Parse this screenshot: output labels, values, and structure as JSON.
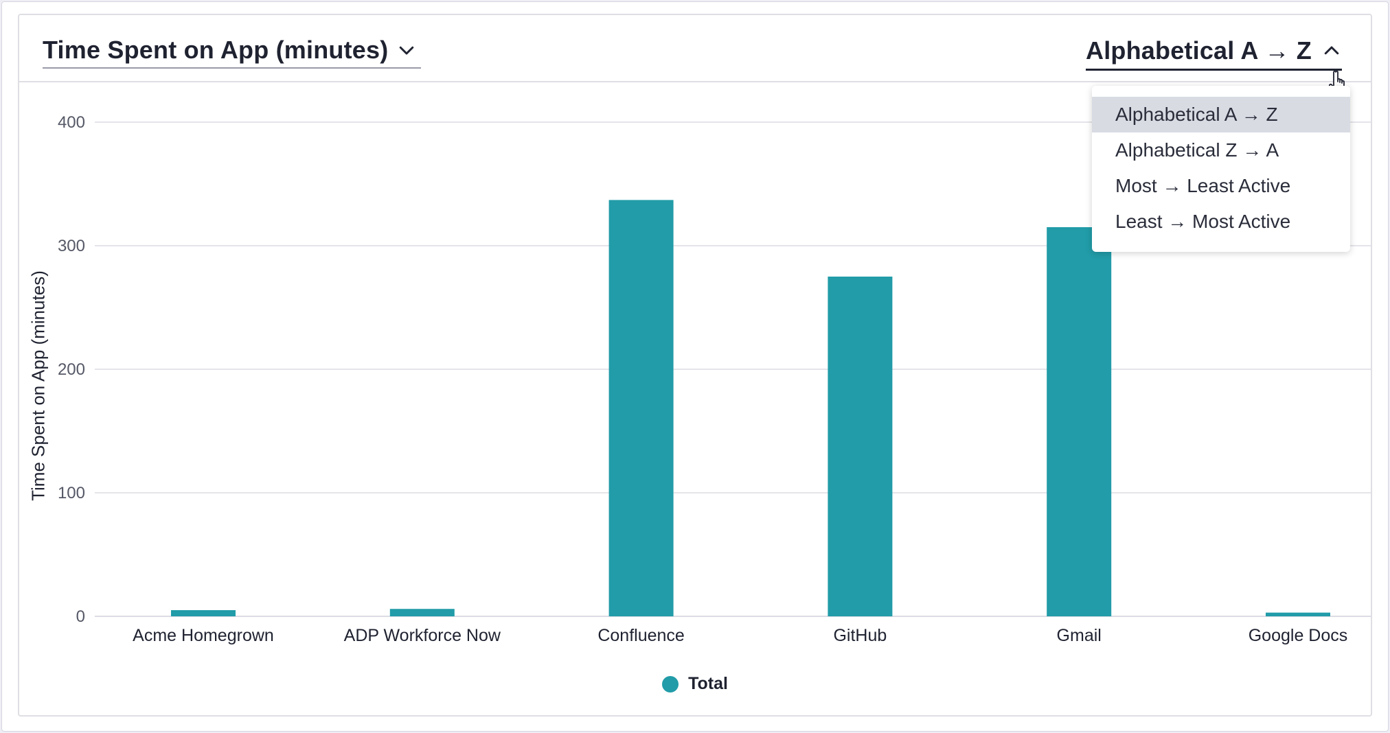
{
  "header": {
    "metric_label": "Time Spent on App (minutes)",
    "sort_label": "Alphabetical A → Z"
  },
  "sort_menu": {
    "options": [
      "Alphabetical A → Z",
      "Alphabetical Z → A",
      "Most → Least Active",
      "Least → Most Active"
    ],
    "selected_index": 0
  },
  "colors": {
    "bar": "#219ca8",
    "grid": "#dcdce4",
    "text": "#1f2230",
    "tick": "#555866"
  },
  "chart_data": {
    "type": "bar",
    "categories": [
      "Acme Homegrown",
      "ADP Workforce Now",
      "Confluence",
      "GitHub",
      "Gmail",
      "Google Docs"
    ],
    "series": [
      {
        "name": "Total",
        "values": [
          5,
          6,
          337,
          275,
          315,
          3
        ]
      }
    ],
    "ylabel": "Time Spent on App (minutes)",
    "yticks": [
      0,
      100,
      200,
      300,
      400
    ],
    "ylim": [
      0,
      400
    ],
    "grid": true,
    "legend": "bottom-center"
  }
}
